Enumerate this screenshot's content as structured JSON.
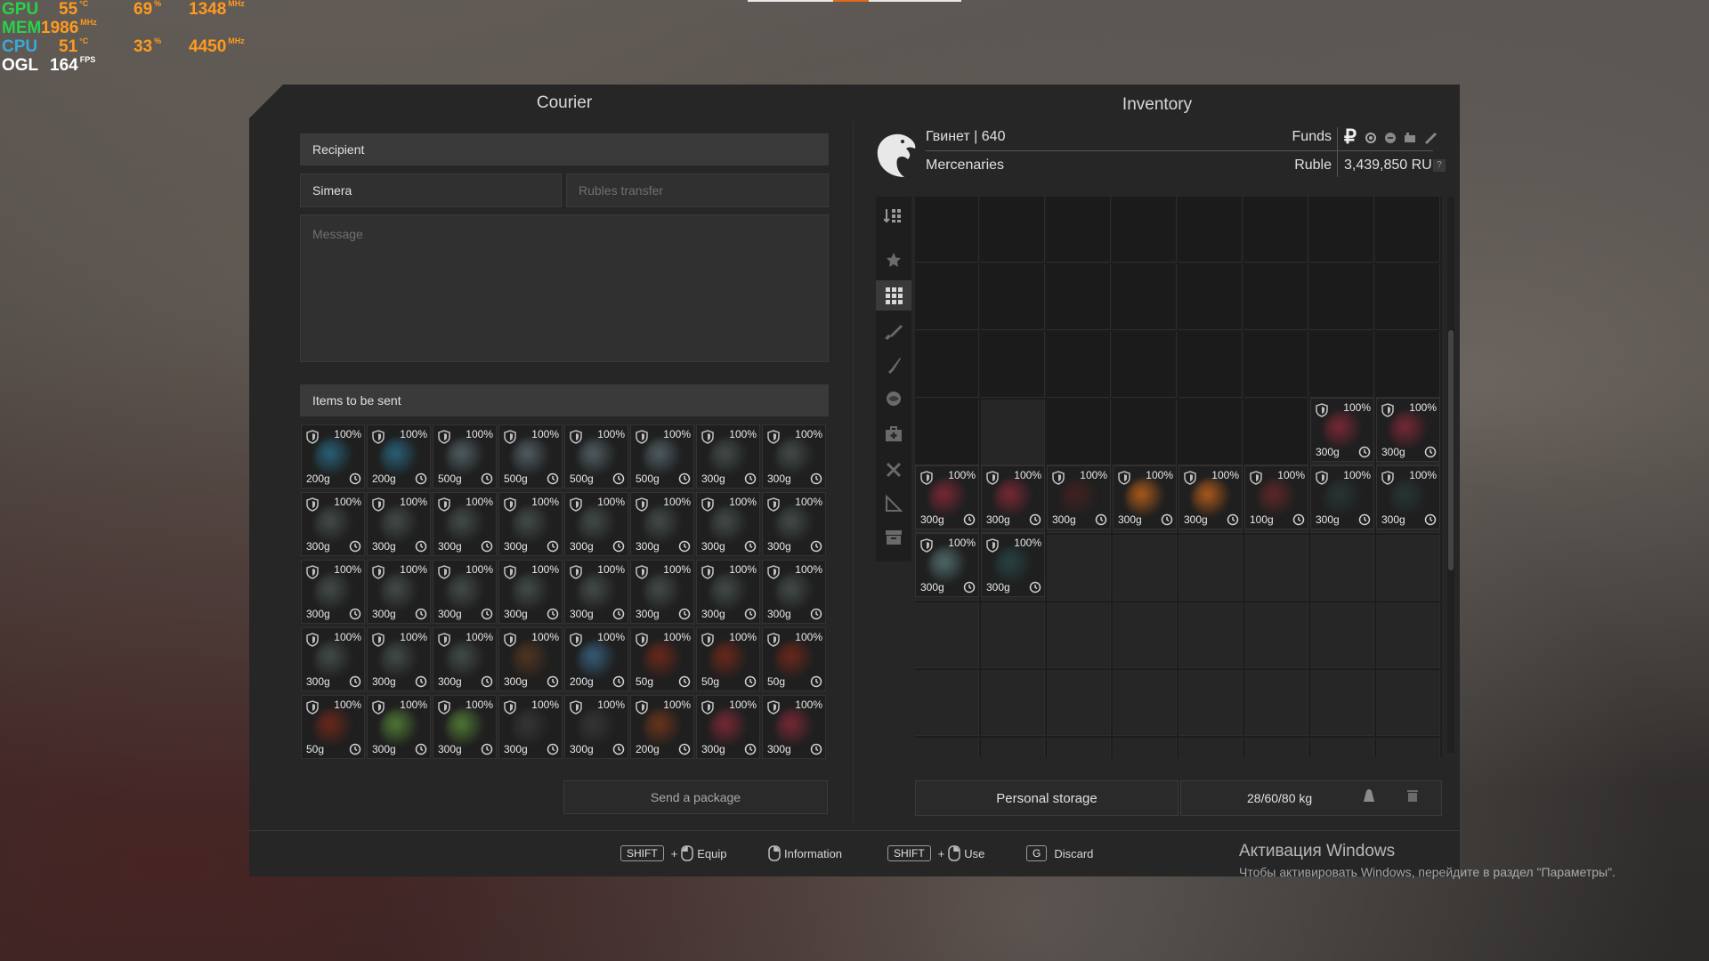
{
  "hud": {
    "gpu": {
      "label": "GPU",
      "temp": "55",
      "temp_unit": "°C",
      "load": "69",
      "load_unit": "%",
      "clock": "1348",
      "clock_unit": "MHz"
    },
    "mem": {
      "label": "MEM",
      "clock": "1986",
      "clock_unit": "MHz"
    },
    "cpu": {
      "label": "CPU",
      "temp": "51",
      "temp_unit": "°C",
      "load": "33",
      "load_unit": "%",
      "clock": "4450",
      "clock_unit": "MHz"
    },
    "ogl": {
      "label": "OGL",
      "fps": "164",
      "fps_unit": "FPS"
    }
  },
  "courier": {
    "title": "Courier",
    "recipient_header": "Recipient",
    "recipient_value": "Simera",
    "rubles_placeholder": "Rubles transfer",
    "message_placeholder": "Message",
    "items_header": "Items to be sent",
    "send_button": "Send a package",
    "items": [
      {
        "pct": "100%",
        "w": "200g",
        "c": "#2a6f8a"
      },
      {
        "pct": "100%",
        "w": "200g",
        "c": "#2a6f8a"
      },
      {
        "pct": "100%",
        "w": "500g",
        "c": "#5a6a70"
      },
      {
        "pct": "100%",
        "w": "500g",
        "c": "#5a6a70"
      },
      {
        "pct": "100%",
        "w": "500g",
        "c": "#5a6a70"
      },
      {
        "pct": "100%",
        "w": "500g",
        "c": "#5a6a70"
      },
      {
        "pct": "100%",
        "w": "300g",
        "c": "#4a5550"
      },
      {
        "pct": "100%",
        "w": "300g",
        "c": "#4a5550"
      },
      {
        "pct": "100%",
        "w": "300g",
        "c": "#4a5550"
      },
      {
        "pct": "100%",
        "w": "300g",
        "c": "#4a5550"
      },
      {
        "pct": "100%",
        "w": "300g",
        "c": "#4a5550"
      },
      {
        "pct": "100%",
        "w": "300g",
        "c": "#4a5550"
      },
      {
        "pct": "100%",
        "w": "300g",
        "c": "#4a5550"
      },
      {
        "pct": "100%",
        "w": "300g",
        "c": "#4a5550"
      },
      {
        "pct": "100%",
        "w": "300g",
        "c": "#4a5550"
      },
      {
        "pct": "100%",
        "w": "300g",
        "c": "#4a5550"
      },
      {
        "pct": "100%",
        "w": "300g",
        "c": "#4a5550"
      },
      {
        "pct": "100%",
        "w": "300g",
        "c": "#4a5550"
      },
      {
        "pct": "100%",
        "w": "300g",
        "c": "#4a5550"
      },
      {
        "pct": "100%",
        "w": "300g",
        "c": "#4a5550"
      },
      {
        "pct": "100%",
        "w": "300g",
        "c": "#4a5550"
      },
      {
        "pct": "100%",
        "w": "300g",
        "c": "#4a5550"
      },
      {
        "pct": "100%",
        "w": "300g",
        "c": "#4a5550"
      },
      {
        "pct": "100%",
        "w": "300g",
        "c": "#4a5550"
      },
      {
        "pct": "100%",
        "w": "300g",
        "c": "#4a5550"
      },
      {
        "pct": "100%",
        "w": "300g",
        "c": "#4a5550"
      },
      {
        "pct": "100%",
        "w": "300g",
        "c": "#4a5550"
      },
      {
        "pct": "100%",
        "w": "300g",
        "c": "#5a3a22"
      },
      {
        "pct": "100%",
        "w": "200g",
        "c": "#3a6a8a"
      },
      {
        "pct": "100%",
        "w": "50g",
        "c": "#7a2a1a"
      },
      {
        "pct": "100%",
        "w": "50g",
        "c": "#7a2a1a"
      },
      {
        "pct": "100%",
        "w": "50g",
        "c": "#7a2a1a"
      },
      {
        "pct": "100%",
        "w": "50g",
        "c": "#7a2a1a"
      },
      {
        "pct": "100%",
        "w": "300g",
        "c": "#5a8a3a"
      },
      {
        "pct": "100%",
        "w": "300g",
        "c": "#5a8a3a"
      },
      {
        "pct": "100%",
        "w": "300g",
        "c": "#3a3a3a"
      },
      {
        "pct": "100%",
        "w": "300g",
        "c": "#3a3a3a"
      },
      {
        "pct": "100%",
        "w": "200g",
        "c": "#7a3a1a"
      },
      {
        "pct": "100%",
        "w": "300g",
        "c": "#8a2a3a"
      },
      {
        "pct": "100%",
        "w": "300g",
        "c": "#8a2a3a"
      }
    ]
  },
  "inventory": {
    "title": "Inventory",
    "player": "Гвинет | 640",
    "faction": "Mercenaries",
    "funds_label": "Funds",
    "currency_label": "Ruble",
    "currency_symbol": "₽",
    "funds_value": "3,439,850 RUB",
    "help_glyph": "?",
    "storage_button": "Personal storage",
    "weight": "28/60/80 kg",
    "items": [
      {
        "col": 6,
        "row": 3,
        "pct": "100%",
        "w": "300g",
        "c": "#8a2a3a"
      },
      {
        "col": 7,
        "row": 3,
        "pct": "100%",
        "w": "300g",
        "c": "#8a2a3a"
      },
      {
        "col": 0,
        "row": 4,
        "pct": "100%",
        "w": "300g",
        "c": "#8a2a3a"
      },
      {
        "col": 1,
        "row": 4,
        "pct": "100%",
        "w": "300g",
        "c": "#8a2a3a"
      },
      {
        "col": 2,
        "row": 4,
        "pct": "100%",
        "w": "300g",
        "c": "#4a2222"
      },
      {
        "col": 3,
        "row": 4,
        "pct": "100%",
        "w": "300g",
        "c": "#c8661a"
      },
      {
        "col": 4,
        "row": 4,
        "pct": "100%",
        "w": "300g",
        "c": "#c8661a"
      },
      {
        "col": 5,
        "row": 4,
        "pct": "100%",
        "w": "100g",
        "c": "#6a2a2a"
      },
      {
        "col": 6,
        "row": 4,
        "pct": "100%",
        "w": "300g",
        "c": "#2a3a3a"
      },
      {
        "col": 7,
        "row": 4,
        "pct": "100%",
        "w": "300g",
        "c": "#2a3a3a"
      },
      {
        "col": 0,
        "row": 5,
        "pct": "100%",
        "w": "300g",
        "c": "#5a7a7a"
      },
      {
        "col": 1,
        "row": 5,
        "pct": "100%",
        "w": "300g",
        "c": "#2a4a4a"
      }
    ]
  },
  "hints": {
    "shift": "SHIFT",
    "plus": "+",
    "equip": "Equip",
    "information": "Information",
    "use": "Use",
    "g_key": "G",
    "discard": "Discard"
  },
  "watermark": {
    "title": "Активация Windows",
    "subtitle": "Чтобы активировать Windows, перейдите в раздел \"Параметры\"."
  }
}
